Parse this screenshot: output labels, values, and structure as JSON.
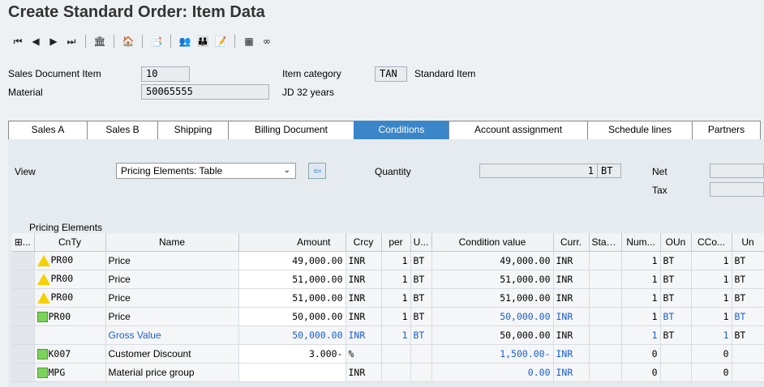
{
  "title": "Create Standard Order: Item Data",
  "header": {
    "sales_doc_item_label": "Sales Document Item",
    "sales_doc_item_value": "10",
    "item_category_label": "Item category",
    "item_category_value": "TAN",
    "item_category_text": "Standard Item",
    "material_label": "Material",
    "material_value": "50065555",
    "material_text": "JD 32 years"
  },
  "tabs": [
    "Sales A",
    "Sales B",
    "Shipping",
    "Billing Document",
    "Conditions",
    "Account assignment",
    "Schedule lines",
    "Partners"
  ],
  "conditions": {
    "view_label": "View",
    "view_value": "Pricing Elements: Table",
    "quantity_label": "Quantity",
    "quantity_value": "1",
    "quantity_unit": "BT",
    "net_label": "Net",
    "tax_label": "Tax",
    "grid_title": "Pricing Elements",
    "columns": [
      "...",
      "CnTy",
      "Name",
      "Amount",
      "Crcy",
      "per",
      "U...",
      "Condition value",
      "Curr.",
      "Status",
      "Num...",
      "OUn",
      "CCo...",
      "Un"
    ],
    "rows": [
      {
        "status": "warn",
        "cnty": "PR00",
        "name": "Price",
        "amount": "49,000.00",
        "crcy": "INR",
        "per": "1",
        "u": "BT",
        "cond_value": "49,000.00",
        "curr": "INR",
        "num": "1",
        "oun": "BT",
        "cco": "1",
        "un": "BT"
      },
      {
        "status": "warn",
        "cnty": "PR00",
        "name": "Price",
        "amount": "51,000.00",
        "crcy": "INR",
        "per": "1",
        "u": "BT",
        "cond_value": "51,000.00",
        "curr": "INR",
        "num": "1",
        "oun": "BT",
        "cco": "1",
        "un": "BT"
      },
      {
        "status": "warn",
        "cnty": "PR00",
        "name": "Price",
        "amount": "51,000.00",
        "crcy": "INR",
        "per": "1",
        "u": "BT",
        "cond_value": "51,000.00",
        "curr": "INR",
        "num": "1",
        "oun": "BT",
        "cco": "1",
        "un": "BT"
      },
      {
        "status": "ok",
        "cnty": "PR00",
        "name": "Price",
        "amount": "50,000.00",
        "crcy": "INR",
        "per": "1",
        "u": "BT",
        "cond_value": "50,000.00",
        "curr": "INR",
        "num": "1",
        "oun": "BT",
        "cco": "1",
        "un": "BT"
      },
      {
        "status": "",
        "cnty": "",
        "name": "Gross Value",
        "amount": "50,000.00",
        "crcy": "INR",
        "per": "1",
        "u": "BT",
        "cond_value": "50,000.00",
        "curr": "INR",
        "num": "1",
        "oun": "BT",
        "cco": "1",
        "un": "BT"
      },
      {
        "status": "ok",
        "cnty": "K007",
        "name": "Customer Discount",
        "amount": "3.000-",
        "crcy": "%",
        "per": "",
        "u": "",
        "cond_value": "1,500.00-",
        "curr": "INR",
        "num": "0",
        "oun": "",
        "cco": "0",
        "un": ""
      },
      {
        "status": "ok",
        "cnty": "MPG",
        "name": "Material price group",
        "amount": "",
        "crcy": "INR",
        "per": "",
        "u": "",
        "cond_value": "0.00",
        "curr": "INR",
        "num": "0",
        "oun": "",
        "cco": "0",
        "un": ""
      }
    ]
  },
  "colors": {
    "accent": "#3a86c8",
    "link_blue": "#1a5fd0",
    "warning": "#f5d000",
    "ok": "#7cd35a"
  }
}
